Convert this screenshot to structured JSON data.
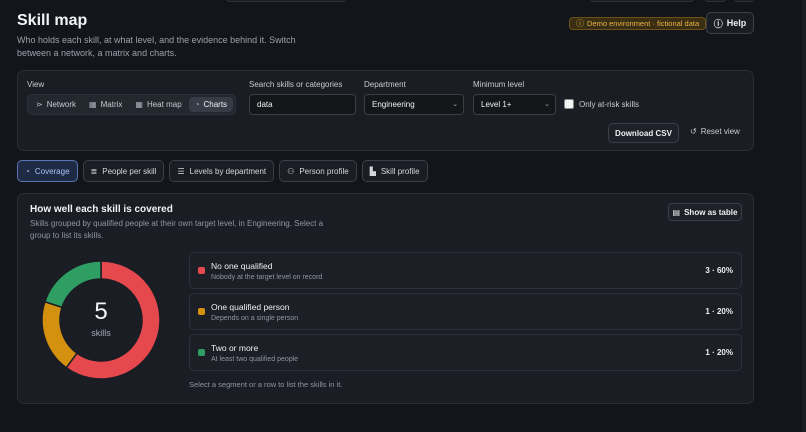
{
  "header": {
    "title": "Skill map",
    "description": "Who holds each skill, at what level, and the evidence behind it. Switch between a network, a matrix and charts.",
    "demo_badge": "Demo environment · fictional data",
    "help_label": "Help"
  },
  "controls": {
    "view_label": "View",
    "views": [
      {
        "label": "Network",
        "icon": "network-icon",
        "active": false
      },
      {
        "label": "Matrix",
        "icon": "grid-icon",
        "active": false
      },
      {
        "label": "Heat map",
        "icon": "heatmap-icon",
        "active": false
      },
      {
        "label": "Charts",
        "icon": "pie-icon",
        "active": true
      }
    ],
    "search_label": "Search skills or categories",
    "search_value": "data",
    "department_label": "Department",
    "department_value": "Engineering",
    "level_label": "Minimum level",
    "level_value": "Level 1+",
    "at_risk_label": "Only at-risk skills",
    "download_label": "Download CSV",
    "reset_label": "Reset view"
  },
  "tabs": [
    {
      "label": "Coverage",
      "icon": "pie-icon",
      "active": true
    },
    {
      "label": "People per skill",
      "icon": "bar-icon",
      "active": false
    },
    {
      "label": "Levels by department",
      "icon": "stack-icon",
      "active": false
    },
    {
      "label": "Person profile",
      "icon": "person-icon",
      "active": false
    },
    {
      "label": "Skill profile",
      "icon": "chart-icon",
      "active": false
    }
  ],
  "card": {
    "title": "How well each skill is covered",
    "description": "Skills grouped by qualified people at their own target level, in Engineering. Select a group to list its skills.",
    "table_button": "Show as table",
    "total": "5",
    "total_unit": "skills",
    "hint": "Select a segment or a row to list the skills in it."
  },
  "colors": {
    "none": "#e5484d",
    "one": "#d4900f",
    "two_plus": "#2f9e63"
  },
  "chart_data": {
    "type": "pie",
    "categories": [
      "No one qualified",
      "One qualified person",
      "Two or more"
    ],
    "values": [
      3,
      1,
      1
    ],
    "percents": [
      60,
      20,
      20
    ],
    "descriptions": [
      "Nobody at the target level on record",
      "Depends on a single person",
      "At least two qualified people"
    ],
    "value_labels": [
      "3 · 60%",
      "1 · 20%",
      "1 · 20%"
    ]
  }
}
